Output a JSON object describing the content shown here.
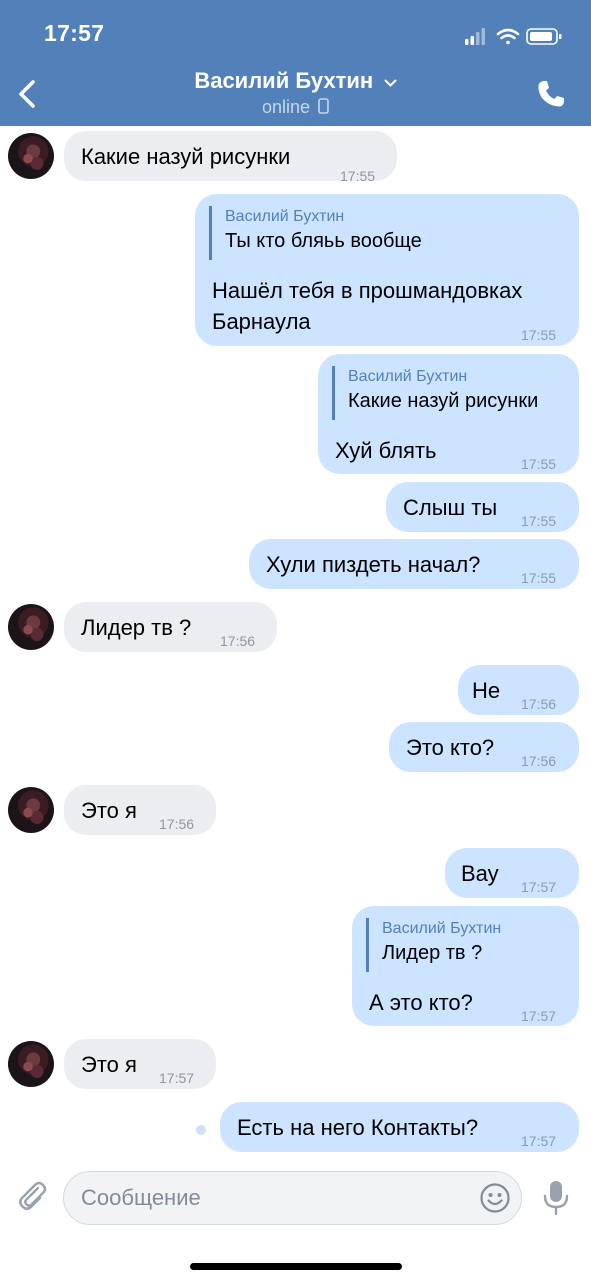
{
  "status_bar": {
    "time": "17:57"
  },
  "header": {
    "title": "Василий Бухтин",
    "subtitle": "online"
  },
  "messages": [
    {
      "text": "Какие назуй рисунки",
      "time": "17:55"
    },
    {
      "reply_name": "Василий Бухтин",
      "reply_text": "Ты кто бляьь вообще",
      "text_line1": "Нашёл тебя в прошмандовках",
      "text_line2": "Барнаула",
      "time": "17:55"
    },
    {
      "reply_name": "Василий Бухтин",
      "reply_text": "Какие назуй рисунки",
      "text": "Хуй блять",
      "time": "17:55"
    },
    {
      "text": "Слыш ты",
      "time": "17:55"
    },
    {
      "text": "Хули пиздеть начал?",
      "time": "17:55"
    },
    {
      "text": "Лидер тв ?",
      "time": "17:56"
    },
    {
      "text": "Не",
      "time": "17:56"
    },
    {
      "text": "Это кто?",
      "time": "17:56"
    },
    {
      "text": "Это я",
      "time": "17:56"
    },
    {
      "text": "Вау",
      "time": "17:57"
    },
    {
      "reply_name": "Василий Бухтин",
      "reply_text": "Лидер тв ?",
      "text": "А это кто?",
      "time": "17:57"
    },
    {
      "text": "Это я",
      "time": "17:57"
    },
    {
      "text": "Есть на него Контакты?",
      "time": "17:57"
    }
  ],
  "composer": {
    "placeholder": "Сообщение"
  },
  "colors": {
    "header": "#5181b8",
    "outgoing_bubble": "#cce4ff",
    "incoming_bubble": "#ebedf0"
  },
  "icons": [
    "chevron-left-icon",
    "phone-icon",
    "paperclip-icon",
    "smile-icon",
    "microphone-icon"
  ]
}
